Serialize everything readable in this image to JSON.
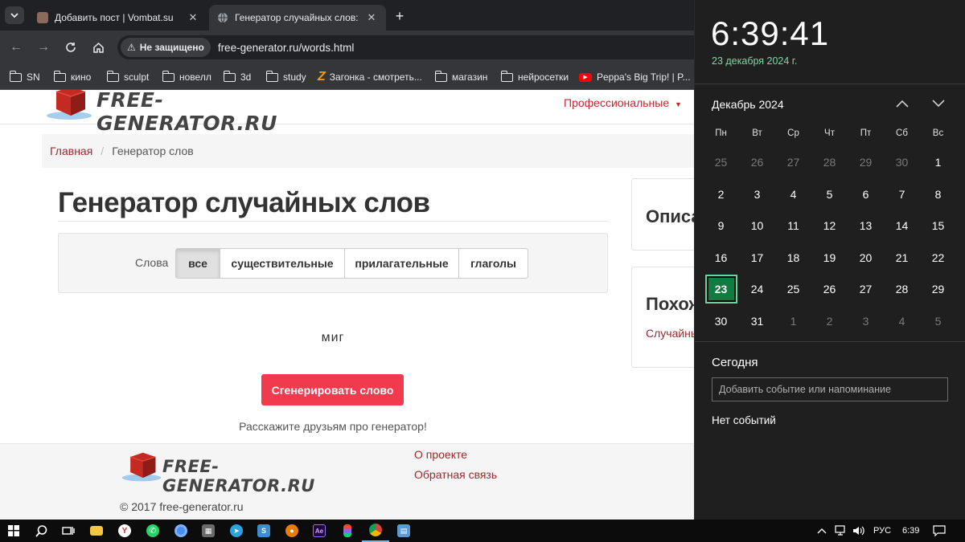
{
  "browser": {
    "tabs": [
      {
        "title": "Добавить пост | Vombat.su",
        "active": false
      },
      {
        "title": "Генератор случайных слов: су",
        "active": true
      }
    ],
    "security_label": "Не защищено",
    "url": "free-generator.ru/words.html",
    "bookmarks": [
      "SN",
      "кино",
      "sculpt",
      "новелл",
      "3d",
      "study",
      "Загонка - смотреть...",
      "магазин",
      "нейросетки",
      "Peppa's Big Trip! | P..."
    ]
  },
  "site": {
    "logo_text": "FREE-GENERATOR.RU",
    "nav_menu": "Профессиональные",
    "breadcrumb": {
      "home": "Главная",
      "sep": "/",
      "current": "Генератор слов"
    },
    "title": "Генератор случайных слов",
    "filter": {
      "label": "Слова",
      "options": [
        "все",
        "существительные",
        "прилагательные",
        "глаголы"
      ],
      "selected": "все"
    },
    "word": "миг",
    "generate_button": "Сгенерировать слово",
    "share_text": "Расскажите друзьям про генератор!",
    "side_panels": [
      {
        "title": "Описа"
      },
      {
        "title": "Похож",
        "link": "Случайны"
      }
    ],
    "footer": {
      "links": [
        "О проекте",
        "Обратная связь"
      ],
      "copyright": "© 2017 free-generator.ru"
    }
  },
  "calendar": {
    "time": "6:39:41",
    "date_long": "23 декабря 2024 г.",
    "month_label": "Декабрь 2024",
    "weekdays": [
      "Пн",
      "Вт",
      "Ср",
      "Чт",
      "Пт",
      "Сб",
      "Вс"
    ],
    "weeks": [
      [
        "25",
        "26",
        "27",
        "28",
        "29",
        "30",
        "1"
      ],
      [
        "2",
        "3",
        "4",
        "5",
        "6",
        "7",
        "8"
      ],
      [
        "9",
        "10",
        "11",
        "12",
        "13",
        "14",
        "15"
      ],
      [
        "16",
        "17",
        "18",
        "19",
        "20",
        "21",
        "22"
      ],
      [
        "23",
        "24",
        "25",
        "26",
        "27",
        "28",
        "29"
      ],
      [
        "30",
        "31",
        "1",
        "2",
        "3",
        "4",
        "5"
      ]
    ],
    "today": "23",
    "today_heading": "Сегодня",
    "event_placeholder": "Добавить событие или напоминание",
    "no_events": "Нет событий"
  },
  "taskbar": {
    "language": "РУС",
    "clock": "6:39",
    "apps": [
      "windows-start",
      "search",
      "task-view",
      "file-explorer",
      "yandex-browser",
      "whatsapp",
      "chromium",
      "calculator",
      "telegram",
      "sublime",
      "blender",
      "after-effects",
      "figma",
      "chrome",
      "remote-desktop"
    ]
  },
  "colors": {
    "accent_red": "#f23a4f",
    "link_red": "#a0292c",
    "today_green": "#107c41",
    "date_green": "#7fd6a6"
  }
}
